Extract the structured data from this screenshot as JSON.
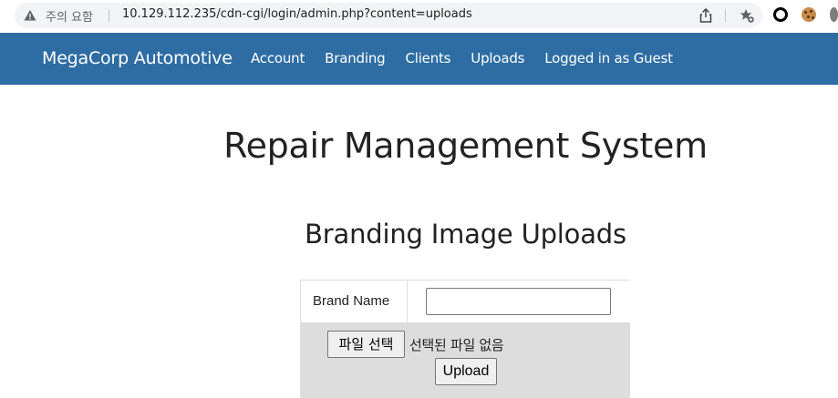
{
  "browser": {
    "security_text": "주의 요함",
    "url": "10.129.112.235/cdn-cgi/login/admin.php?content=uploads",
    "icons": [
      "warning-icon",
      "share-icon",
      "bookmark-star-icon",
      "extension-ring-icon",
      "cookie-extension-icon",
      "profile-icon"
    ]
  },
  "navbar": {
    "brand": "MegaCorp Automotive",
    "links": [
      "Account",
      "Branding",
      "Clients",
      "Uploads"
    ],
    "status": "Logged in as Guest",
    "background": "#2e6da4"
  },
  "main": {
    "title": "Repair Management System",
    "section_title": "Branding Image Uploads",
    "form": {
      "brand_label": "Brand Name",
      "brand_value": "",
      "file_button": "파일 선택",
      "file_status": "선택된 파일 없음",
      "upload_button": "Upload"
    }
  }
}
